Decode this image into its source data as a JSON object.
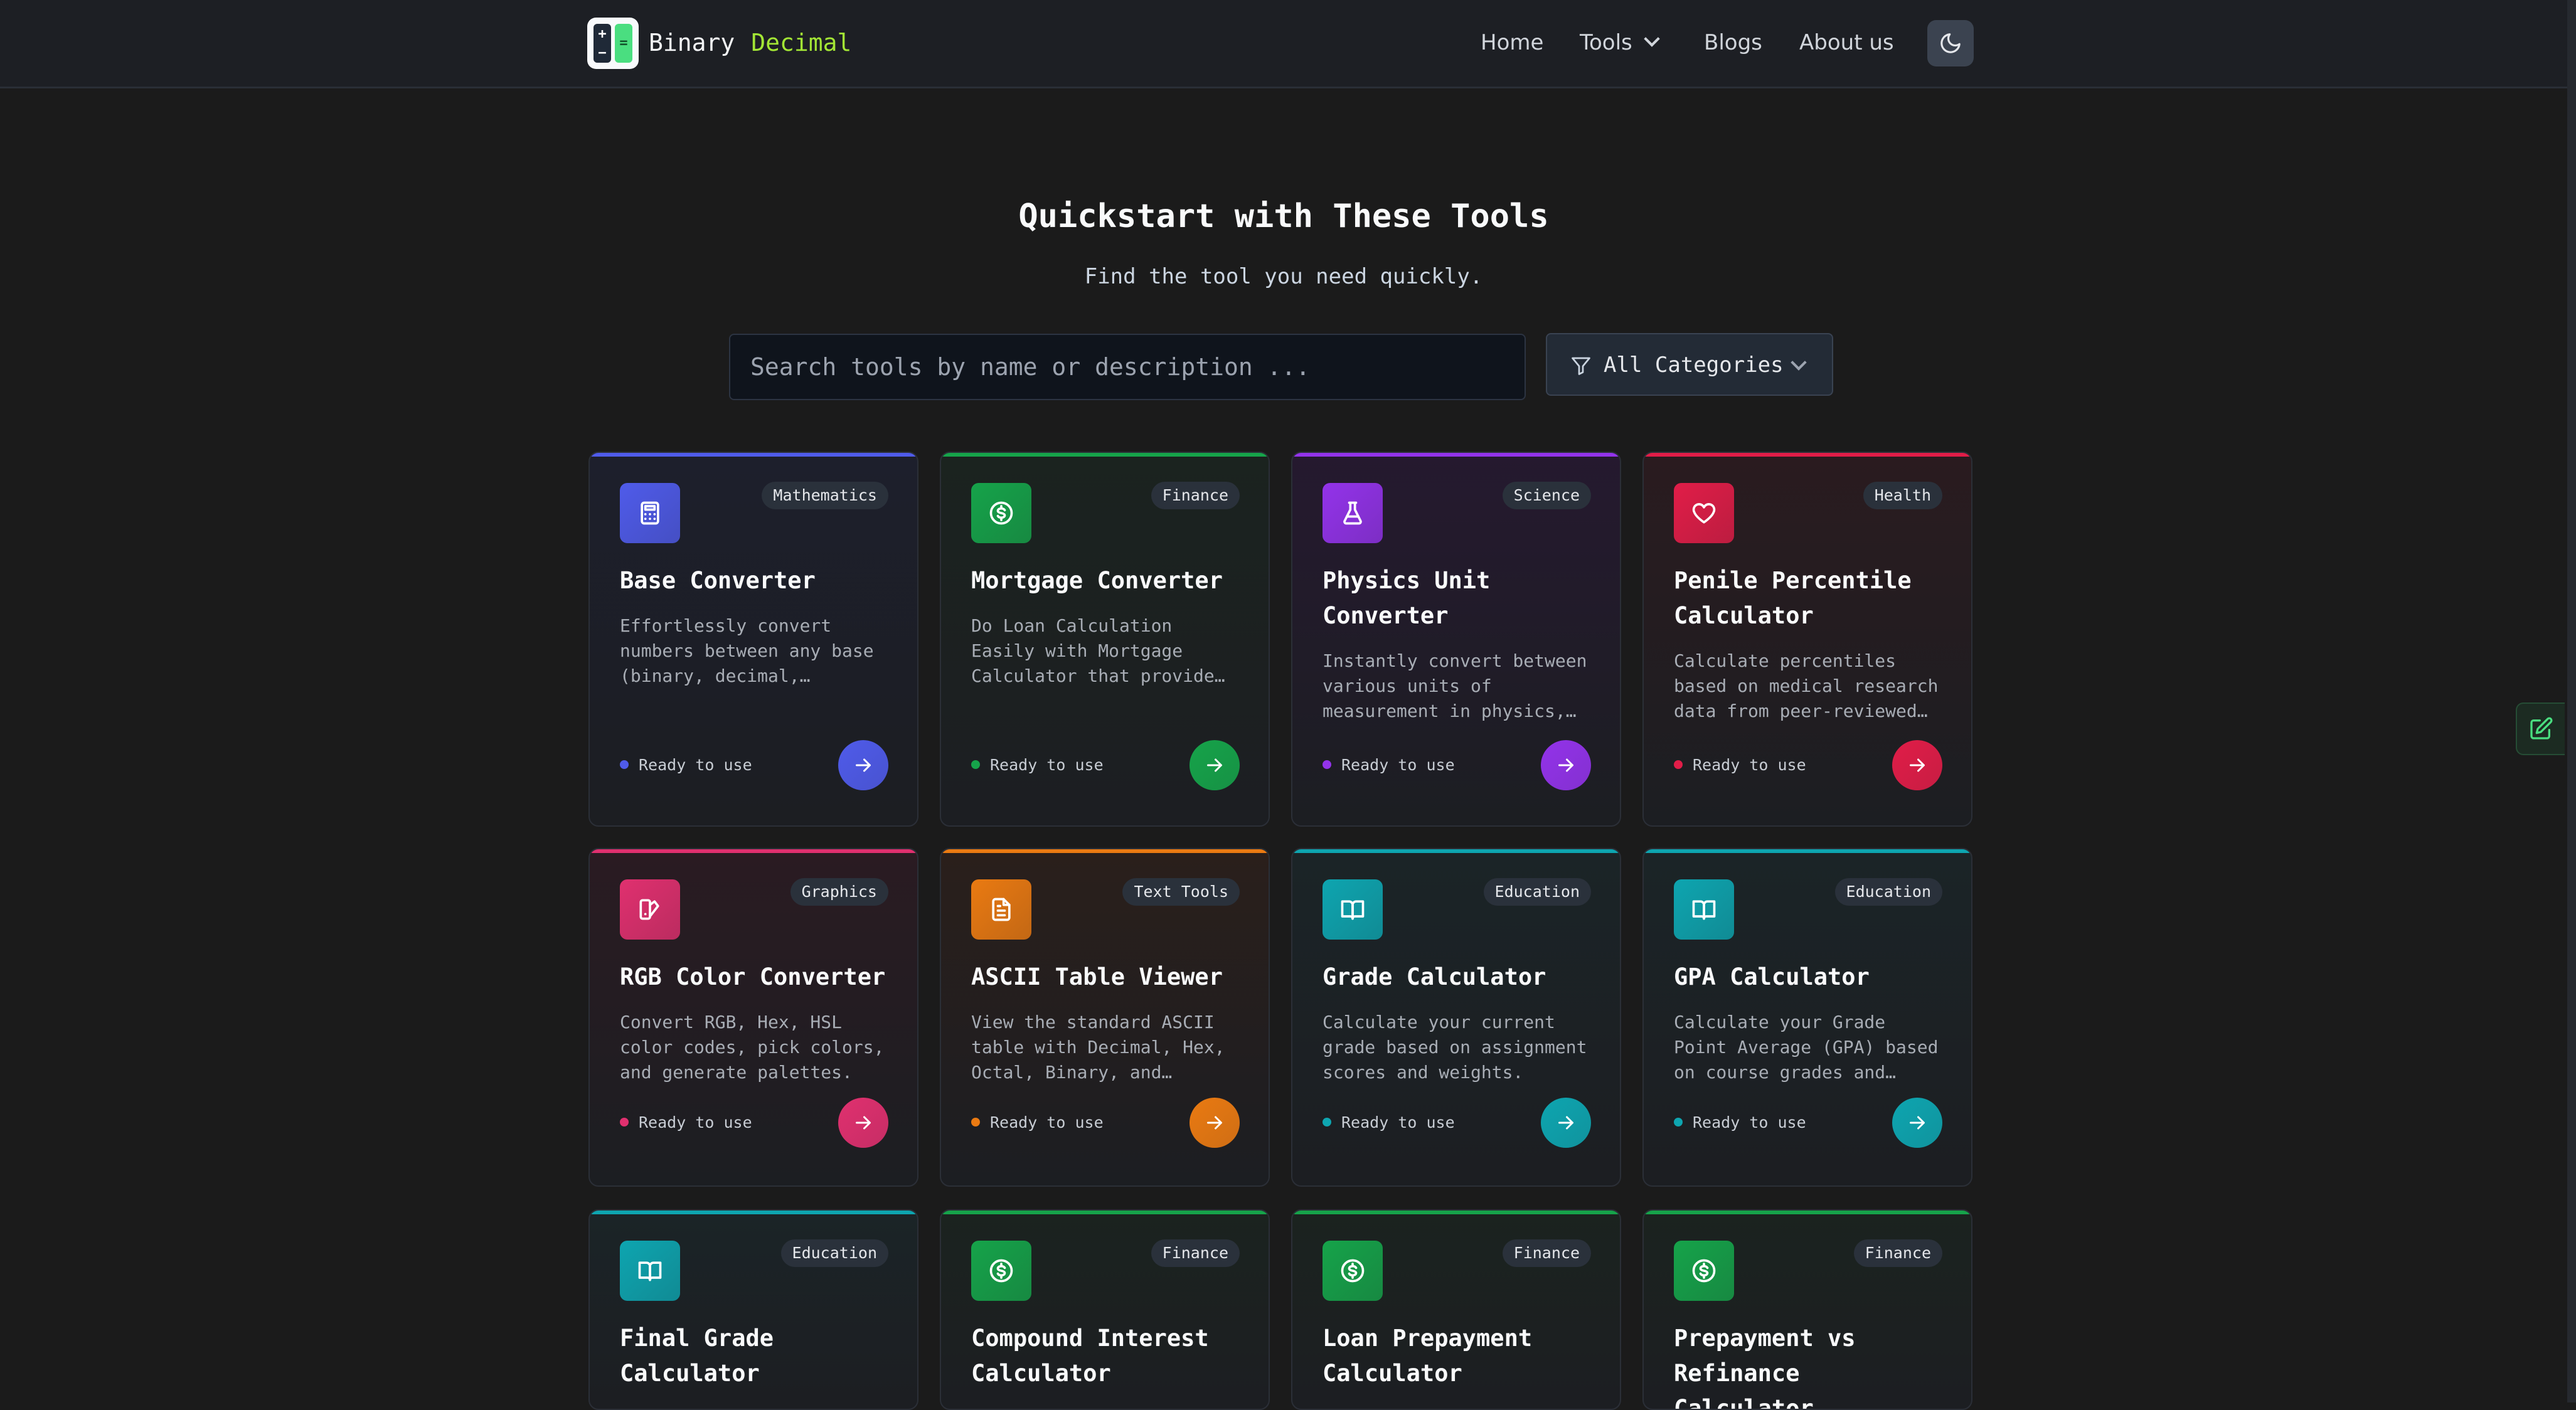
{
  "header": {
    "brand_first": "Binary",
    "brand_second": "Decimal",
    "nav": {
      "home": "Home",
      "tools": "Tools",
      "blogs": "Blogs",
      "about": "About us"
    },
    "theme_toggle_icon": "moon-icon"
  },
  "hero": {
    "title": "Quickstart with These Tools",
    "subtitle": "Find the tool you need quickly."
  },
  "search": {
    "placeholder": "Search tools by name or description ...",
    "category_filter": "All Categories",
    "filter_icon": "filter-icon"
  },
  "side_tab": {
    "icon": "edit-icon"
  },
  "colors": {
    "mathematics": "#4f5bea",
    "finance": "#16a34a",
    "science": "#9333ea",
    "health": "#e11d48",
    "graphics": "#e0306f",
    "text_tools": "#ea7a12",
    "education": "#0ea5b0",
    "brand_accent": "#a3e635"
  },
  "tools": [
    {
      "title": "Base Converter",
      "category": "Mathematics",
      "description": "Effortlessly convert numbers between any base (binary, decimal,…",
      "status": "Ready to use",
      "icon": "calculator-icon"
    },
    {
      "title": "Mortgage Converter",
      "category": "Finance",
      "description": "Do Loan Calculation Easily with Mortgage Calculator that provide…",
      "status": "Ready to use",
      "icon": "dollar-icon"
    },
    {
      "title": "Physics Unit Converter",
      "category": "Science",
      "description": "Instantly convert between various units of measurement in physics,…",
      "status": "Ready to use",
      "icon": "flask-icon"
    },
    {
      "title": "Penile Percentile Calculator",
      "category": "Health",
      "description": "Calculate percentiles based on medical research data from peer-reviewed…",
      "status": "Ready to use",
      "icon": "heart-icon"
    },
    {
      "title": "RGB Color Converter",
      "category": "Graphics",
      "description": "Convert RGB, Hex, HSL color codes, pick colors, and generate palettes.",
      "status": "Ready to use",
      "icon": "palette-icon"
    },
    {
      "title": "ASCII Table Viewer",
      "category": "Text Tools",
      "description": "View the standard ASCII table with Decimal, Hex, Octal, Binary, and…",
      "status": "Ready to use",
      "icon": "document-icon"
    },
    {
      "title": "Grade Calculator",
      "category": "Education",
      "description": "Calculate your current grade based on assignment scores and weights.",
      "status": "Ready to use",
      "icon": "book-icon"
    },
    {
      "title": "GPA Calculator",
      "category": "Education",
      "description": "Calculate your Grade Point Average (GPA) based on course grades and…",
      "status": "Ready to use",
      "icon": "book-icon"
    },
    {
      "title": "Final Grade Calculator",
      "category": "Education",
      "description": "",
      "status": "",
      "icon": "book-icon"
    },
    {
      "title": "Compound Interest Calculator",
      "category": "Finance",
      "description": "",
      "status": "",
      "icon": "dollar-icon"
    },
    {
      "title": "Loan Prepayment Calculator",
      "category": "Finance",
      "description": "",
      "status": "",
      "icon": "dollar-icon"
    },
    {
      "title": "Prepayment vs Refinance Calculator",
      "category": "Finance",
      "description": "",
      "status": "",
      "icon": "dollar-icon"
    }
  ]
}
